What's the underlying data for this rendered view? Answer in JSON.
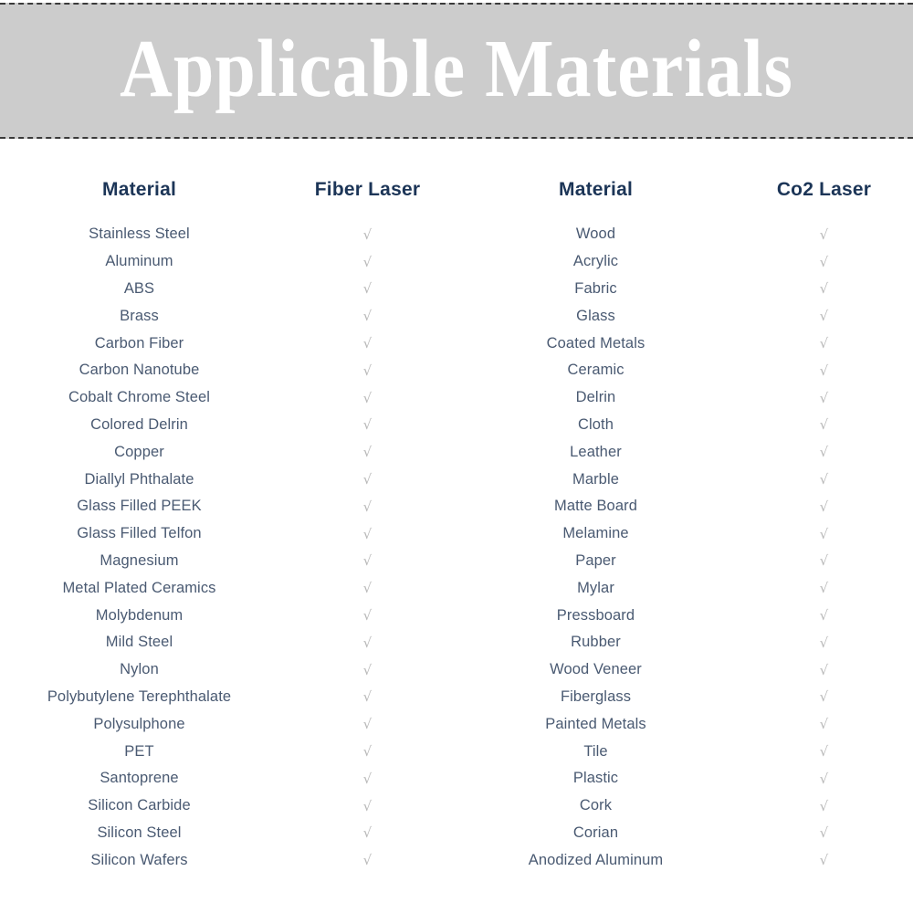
{
  "banner": {
    "title": "Applicable Materials",
    "background_color": "#cccccc",
    "text_color": "#ffffff",
    "border_style": "dashed",
    "border_color": "#3a3a3a"
  },
  "colors": {
    "header_text": "#1c3557",
    "body_text": "#4a5a72",
    "check_mark": "#b9b9b9",
    "page_background": "#ffffff"
  },
  "table": {
    "headers": {
      "material_left": "Material",
      "laser_left": "Fiber Laser",
      "material_right": "Material",
      "laser_right": "Co2 Laser"
    },
    "check_symbol": "√",
    "rows": [
      {
        "material_left": "Stainless Steel",
        "fiber_laser": "√",
        "material_right": "Wood",
        "co2_laser": "√"
      },
      {
        "material_left": "Aluminum",
        "fiber_laser": "√",
        "material_right": "Acrylic",
        "co2_laser": "√"
      },
      {
        "material_left": "ABS",
        "fiber_laser": "√",
        "material_right": "Fabric",
        "co2_laser": "√"
      },
      {
        "material_left": "Brass",
        "fiber_laser": "√",
        "material_right": "Glass",
        "co2_laser": "√"
      },
      {
        "material_left": "Carbon Fiber",
        "fiber_laser": "√",
        "material_right": "Coated Metals",
        "co2_laser": "√"
      },
      {
        "material_left": "Carbon Nanotube",
        "fiber_laser": "√",
        "material_right": "Ceramic",
        "co2_laser": "√"
      },
      {
        "material_left": "Cobalt Chrome Steel",
        "fiber_laser": "√",
        "material_right": "Delrin",
        "co2_laser": "√"
      },
      {
        "material_left": "Colored Delrin",
        "fiber_laser": "√",
        "material_right": "Cloth",
        "co2_laser": "√"
      },
      {
        "material_left": "Copper",
        "fiber_laser": "√",
        "material_right": "Leather",
        "co2_laser": "√"
      },
      {
        "material_left": "Diallyl Phthalate",
        "fiber_laser": "√",
        "material_right": "Marble",
        "co2_laser": "√"
      },
      {
        "material_left": "Glass Filled PEEK",
        "fiber_laser": "√",
        "material_right": "Matte Board",
        "co2_laser": "√"
      },
      {
        "material_left": "Glass Filled Telfon",
        "fiber_laser": "√",
        "material_right": "Melamine",
        "co2_laser": "√"
      },
      {
        "material_left": "Magnesium",
        "fiber_laser": "√",
        "material_right": "Paper",
        "co2_laser": "√"
      },
      {
        "material_left": "Metal Plated Ceramics",
        "fiber_laser": "√",
        "material_right": "Mylar",
        "co2_laser": "√"
      },
      {
        "material_left": "Molybdenum",
        "fiber_laser": "√",
        "material_right": "Pressboard",
        "co2_laser": "√"
      },
      {
        "material_left": "Mild Steel",
        "fiber_laser": "√",
        "material_right": "Rubber",
        "co2_laser": "√"
      },
      {
        "material_left": "Nylon",
        "fiber_laser": "√",
        "material_right": "Wood Veneer",
        "co2_laser": "√"
      },
      {
        "material_left": "Polybutylene Terephthalate",
        "fiber_laser": "√",
        "material_right": "Fiberglass",
        "co2_laser": "√"
      },
      {
        "material_left": "Polysulphone",
        "fiber_laser": "√",
        "material_right": "Painted Metals",
        "co2_laser": "√"
      },
      {
        "material_left": "PET",
        "fiber_laser": "√",
        "material_right": "Tile",
        "co2_laser": "√"
      },
      {
        "material_left": "Santoprene",
        "fiber_laser": "√",
        "material_right": "Plastic",
        "co2_laser": "√"
      },
      {
        "material_left": "Silicon Carbide",
        "fiber_laser": "√",
        "material_right": "Cork",
        "co2_laser": "√"
      },
      {
        "material_left": "Silicon Steel",
        "fiber_laser": "√",
        "material_right": "Corian",
        "co2_laser": "√"
      },
      {
        "material_left": "Silicon Wafers",
        "fiber_laser": "√",
        "material_right": "Anodized Aluminum",
        "co2_laser": "√"
      }
    ]
  }
}
